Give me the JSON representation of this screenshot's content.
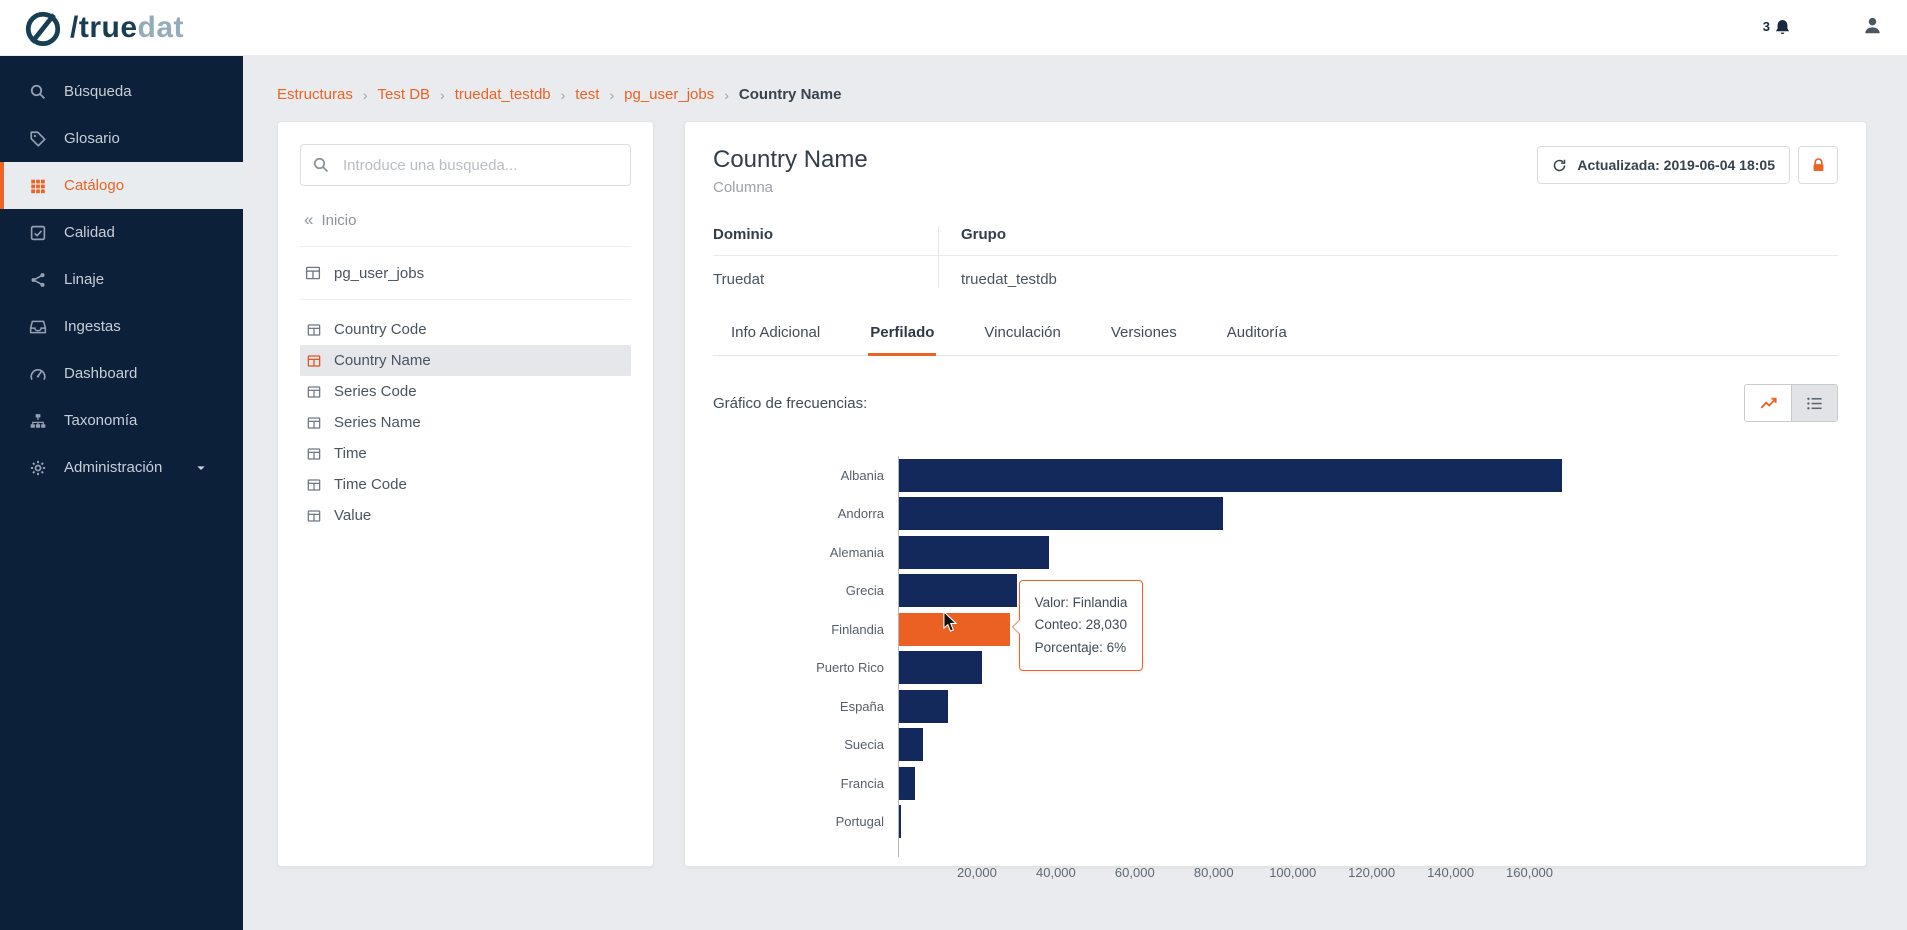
{
  "header": {
    "logo": {
      "brand_primary": "/true",
      "brand_secondary": "dat"
    },
    "notification_count": "3"
  },
  "sidebar": {
    "items": [
      {
        "label": "Búsqueda",
        "icon": "search-icon",
        "active": false
      },
      {
        "label": "Glosario",
        "icon": "tag-icon",
        "active": false
      },
      {
        "label": "Catálogo",
        "icon": "grid-icon",
        "active": true
      },
      {
        "label": "Calidad",
        "icon": "check-square-icon",
        "active": false
      },
      {
        "label": "Linaje",
        "icon": "share-icon",
        "active": false
      },
      {
        "label": "Ingestas",
        "icon": "inbox-icon",
        "active": false
      },
      {
        "label": "Dashboard",
        "icon": "dashboard-icon",
        "active": false
      },
      {
        "label": "Taxonomía",
        "icon": "sitemap-icon",
        "active": false
      },
      {
        "label": "Administración",
        "icon": "gear-icon",
        "active": false,
        "has_caret": true
      }
    ]
  },
  "breadcrumb": {
    "links": [
      "Estructuras",
      "Test DB",
      "truedat_testdb",
      "test",
      "pg_user_jobs"
    ],
    "separator": "›",
    "current": "Country Name"
  },
  "explorer": {
    "search_placeholder": "Introduce una busqueda...",
    "back_label": "Inicio",
    "back_glyph": "«",
    "parent_item": "pg_user_jobs",
    "columns": [
      {
        "label": "Country Code",
        "active": false
      },
      {
        "label": "Country Name",
        "active": true
      },
      {
        "label": "Series Code",
        "active": false
      },
      {
        "label": "Series Name",
        "active": false
      },
      {
        "label": "Time",
        "active": false
      },
      {
        "label": "Time Code",
        "active": false
      },
      {
        "label": "Value",
        "active": false
      }
    ]
  },
  "detail": {
    "title": "Country Name",
    "subtitle": "Columna",
    "updated_label": "Actualizada: 2019-06-04 18:05",
    "fields": [
      {
        "label": "Dominio",
        "value": "Truedat"
      },
      {
        "label": "Grupo",
        "value": "truedat_testdb"
      }
    ],
    "tabs": [
      {
        "label": "Info Adicional",
        "active": false
      },
      {
        "label": "Perfilado",
        "active": true
      },
      {
        "label": "Vinculación",
        "active": false
      },
      {
        "label": "Versiones",
        "active": false
      },
      {
        "label": "Auditoría",
        "active": false
      }
    ],
    "section_label": "Gráfico de frecuencias:",
    "view_toggle": {
      "options": [
        "chart",
        "list"
      ],
      "active": "chart"
    }
  },
  "chart_data": {
    "type": "bar",
    "orientation": "horizontal",
    "title": "Gráfico de frecuencias",
    "categories": [
      "Albania",
      "Andorra",
      "Alemania",
      "Grecia",
      "Finlandia",
      "Puerto Rico",
      "España",
      "Suecia",
      "Francia",
      "Portugal"
    ],
    "values": [
      168000,
      82000,
      38000,
      30000,
      28030,
      21000,
      12500,
      6000,
      4000,
      500
    ],
    "highlight_index": 4,
    "xlim": [
      0,
      170000
    ],
    "x_ticks": [
      20000,
      40000,
      60000,
      80000,
      100000,
      120000,
      140000,
      160000
    ],
    "x_tick_labels": [
      "20,000",
      "40,000",
      "60,000",
      "80,000",
      "100,000",
      "120,000",
      "140,000",
      "160,000"
    ],
    "grid": false,
    "legend": false,
    "tooltip": {
      "lines": [
        "Valor: Finlandia",
        "Conteo: 28,030",
        "Porcentaje: 6%"
      ]
    }
  },
  "colors": {
    "accent": "#ec6325",
    "bar": "#14295b",
    "bar_highlight": "#eb6124",
    "sidebar_bg": "#0d203a"
  }
}
